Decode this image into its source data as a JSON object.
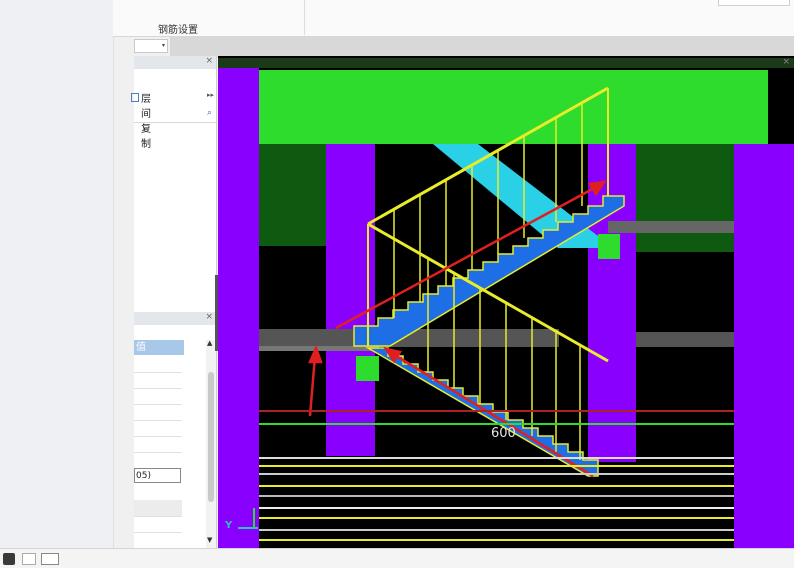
{
  "ribbon": {
    "rebar_settings_label": "钢筋设置"
  },
  "panel_top": {
    "close_label": "×",
    "floor_copy_label": "层间复制",
    "expand_label": "▸▸",
    "search_icon": "⌕"
  },
  "panel_bottom": {
    "close_label": "×",
    "header_label": "值",
    "value_box_text": "05)",
    "scroll_up": "▲",
    "scroll_down": "▼"
  },
  "viewport": {
    "close_label": "×",
    "dimension_label": "600",
    "axis_label": "Y"
  },
  "colors": {
    "purple": "#8a00ff",
    "green": "#2ddc2d",
    "stair_blue": "#1e6fe6",
    "yellow": "#e8ec2a",
    "red": "#e02020",
    "cyan": "#29d0e6"
  }
}
